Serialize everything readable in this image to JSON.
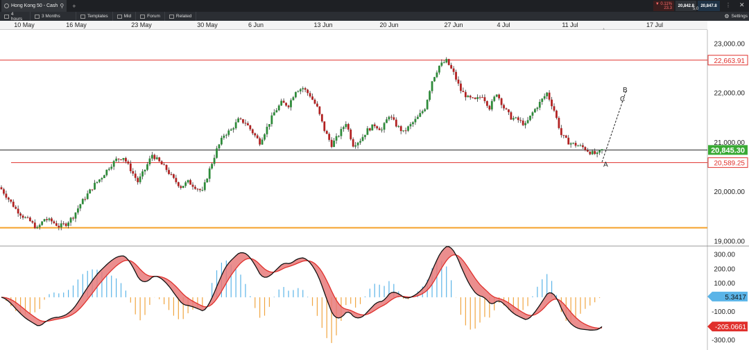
{
  "header": {
    "tab_title": "Hong Kong 50 - Cash",
    "sell_change": "▼ 0.11%",
    "sell_sub": "23.3",
    "sell_price": "20,842.8",
    "spread": "5.0",
    "buy_price": "20,847.8"
  },
  "toolbar": {
    "interval": "4 hours",
    "range": "3 Months",
    "templates": "Templates",
    "mid": "Mid",
    "forum": "Forum",
    "related": "Related",
    "settings": "Settings"
  },
  "colors": {
    "up": "#2e8b3a",
    "down": "#b22222",
    "red_line": "#e0302c",
    "orange_line": "#f5a029",
    "macd_fill": "#e87a7a",
    "hist_pos": "#5ab4e8",
    "hist_neg": "#f0a540",
    "current_badge": "#3aaa35"
  },
  "chart_data": [
    {
      "type": "candlestick",
      "instrument": "Hong Kong 50 - Cash",
      "interval": "4 hours",
      "x_ticks": [
        "10 May",
        "16 May",
        "23 May",
        "30 May",
        "6 Jun",
        "13 Jun",
        "20 Jun",
        "27 Jun",
        "4 Jul",
        "11 Jul",
        "17 Jul"
      ],
      "y_ticks": [
        "23,000.00",
        "22,000.00",
        "21,000.00",
        "20,000.00",
        "19,000.00"
      ],
      "ylim": [
        18900,
        23250
      ],
      "close_path": [
        [
          0,
          20050
        ],
        [
          3,
          19850
        ],
        [
          6,
          19650
        ],
        [
          9,
          19500
        ],
        [
          12,
          19400
        ],
        [
          15,
          19250
        ],
        [
          18,
          19450
        ],
        [
          21,
          19400
        ],
        [
          24,
          19300
        ],
        [
          27,
          19350
        ],
        [
          30,
          19500
        ],
        [
          33,
          19750
        ],
        [
          36,
          19950
        ],
        [
          39,
          20150
        ],
        [
          42,
          20300
        ],
        [
          45,
          20500
        ],
        [
          48,
          20650
        ],
        [
          51,
          20700
        ],
        [
          54,
          20450
        ],
        [
          57,
          20200
        ],
        [
          60,
          20450
        ],
        [
          63,
          20750
        ],
        [
          66,
          20600
        ],
        [
          69,
          20450
        ],
        [
          72,
          20250
        ],
        [
          75,
          20100
        ],
        [
          78,
          20200
        ],
        [
          81,
          20100
        ],
        [
          84,
          20000
        ],
        [
          87,
          20450
        ],
        [
          90,
          20850
        ],
        [
          93,
          21150
        ],
        [
          96,
          21250
        ],
        [
          99,
          21450
        ],
        [
          102,
          21400
        ],
        [
          105,
          21200
        ],
        [
          108,
          21000
        ],
        [
          111,
          21300
        ],
        [
          114,
          21600
        ],
        [
          117,
          21800
        ],
        [
          120,
          21750
        ],
        [
          123,
          22050
        ],
        [
          126,
          22100
        ],
        [
          129,
          21950
        ],
        [
          132,
          21700
        ],
        [
          135,
          21250
        ],
        [
          138,
          20950
        ],
        [
          141,
          21150
        ],
        [
          144,
          21400
        ],
        [
          147,
          20950
        ],
        [
          150,
          21050
        ],
        [
          153,
          21250
        ],
        [
          156,
          21350
        ],
        [
          159,
          21250
        ],
        [
          162,
          21550
        ],
        [
          165,
          21350
        ],
        [
          168,
          21200
        ],
        [
          171,
          21350
        ],
        [
          174,
          21500
        ],
        [
          177,
          21700
        ],
        [
          180,
          22250
        ],
        [
          183,
          22550
        ],
        [
          186,
          22650
        ],
        [
          189,
          22400
        ],
        [
          192,
          22050
        ],
        [
          195,
          21900
        ],
        [
          198,
          21850
        ],
        [
          201,
          21950
        ],
        [
          204,
          21700
        ],
        [
          207,
          22000
        ],
        [
          210,
          21700
        ],
        [
          213,
          21500
        ],
        [
          216,
          21450
        ],
        [
          219,
          21350
        ],
        [
          222,
          21600
        ],
        [
          225,
          21800
        ],
        [
          228,
          22000
        ],
        [
          231,
          21650
        ],
        [
          234,
          21150
        ],
        [
          237,
          21000
        ],
        [
          240,
          20950
        ],
        [
          243,
          20900
        ],
        [
          246,
          20800
        ],
        [
          249,
          20750
        ],
        [
          251,
          20845
        ]
      ],
      "price_lines": [
        {
          "label": "22,663.91",
          "value": 22663.91,
          "color": "#e0302c"
        },
        {
          "label": "20,845.30",
          "value": 20845.3,
          "color": "#222222",
          "current": true
        },
        {
          "label": "20,589.25",
          "value": 20589.25,
          "color": "#e0302c"
        },
        {
          "value": 19270,
          "color": "#f5a029"
        }
      ],
      "projection_labels": [
        "A",
        "B",
        "C"
      ]
    },
    {
      "type": "line",
      "indicator": "MACD",
      "y_ticks": [
        "300.00",
        "200.00",
        "100.00",
        "-100.00",
        "-300.00"
      ],
      "ylim": [
        -360,
        330
      ],
      "badges": [
        {
          "label": "5.3417",
          "value": 5.3417
        },
        {
          "label": "-205.0661",
          "value": -205.0661
        }
      ]
    }
  ]
}
